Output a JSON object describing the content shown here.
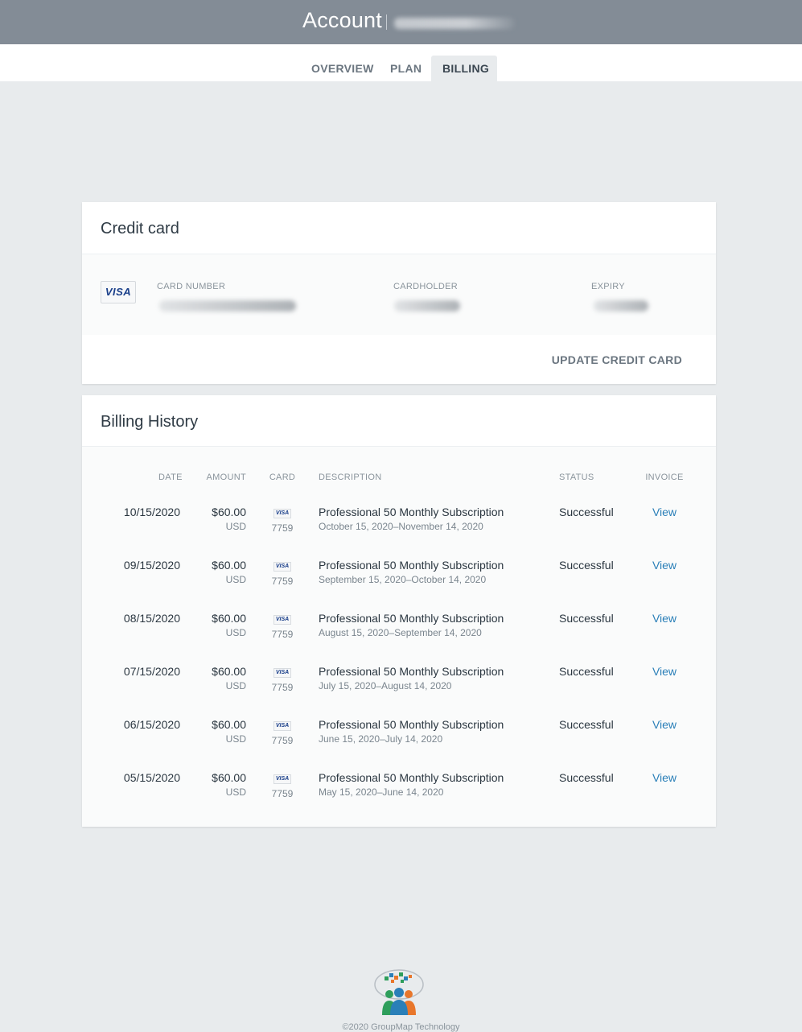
{
  "header": {
    "title": "Account"
  },
  "tabs": [
    {
      "label": "OVERVIEW",
      "active": false
    },
    {
      "label": "PLAN",
      "active": false
    },
    {
      "label": "BILLING",
      "active": true
    }
  ],
  "credit_card": {
    "title": "Credit card",
    "brand": "VISA",
    "number_label": "CARD NUMBER",
    "cardholder_label": "CARDHOLDER",
    "expiry_label": "EXPIRY",
    "update_label": "UPDATE CREDIT CARD"
  },
  "billing_history": {
    "title": "Billing History",
    "columns": [
      "DATE",
      "AMOUNT",
      "CARD",
      "DESCRIPTION",
      "STATUS",
      "INVOICE"
    ],
    "rows": [
      {
        "date": "10/15/2020",
        "amount": "$60.00",
        "currency": "USD",
        "card_brand": "VISA",
        "card_last4": "7759",
        "description": "Professional 50 Monthly Subscription",
        "period": "October 15, 2020–November 14, 2020",
        "status": "Successful",
        "invoice": "View"
      },
      {
        "date": "09/15/2020",
        "amount": "$60.00",
        "currency": "USD",
        "card_brand": "VISA",
        "card_last4": "7759",
        "description": "Professional 50 Monthly Subscription",
        "period": "September 15, 2020–October 14, 2020",
        "status": "Successful",
        "invoice": "View"
      },
      {
        "date": "08/15/2020",
        "amount": "$60.00",
        "currency": "USD",
        "card_brand": "VISA",
        "card_last4": "7759",
        "description": "Professional 50 Monthly Subscription",
        "period": "August 15, 2020–September 14, 2020",
        "status": "Successful",
        "invoice": "View"
      },
      {
        "date": "07/15/2020",
        "amount": "$60.00",
        "currency": "USD",
        "card_brand": "VISA",
        "card_last4": "7759",
        "description": "Professional 50 Monthly Subscription",
        "period": "July 15, 2020–August 14, 2020",
        "status": "Successful",
        "invoice": "View"
      },
      {
        "date": "06/15/2020",
        "amount": "$60.00",
        "currency": "USD",
        "card_brand": "VISA",
        "card_last4": "7759",
        "description": "Professional 50 Monthly Subscription",
        "period": "June 15, 2020–July 14, 2020",
        "status": "Successful",
        "invoice": "View"
      },
      {
        "date": "05/15/2020",
        "amount": "$60.00",
        "currency": "USD",
        "card_brand": "VISA",
        "card_last4": "7759",
        "description": "Professional 50 Monthly Subscription",
        "period": "May 15, 2020–June 14, 2020",
        "status": "Successful",
        "invoice": "View"
      }
    ]
  },
  "footer": {
    "logo_icon": "groupmap-logo-icon",
    "copyright": "©2020 GroupMap Technology"
  },
  "colors": {
    "header_bg": "#838c96",
    "page_bg": "#e8ebed",
    "link": "#2a7fb8",
    "visa_blue": "#1a3f8a"
  }
}
